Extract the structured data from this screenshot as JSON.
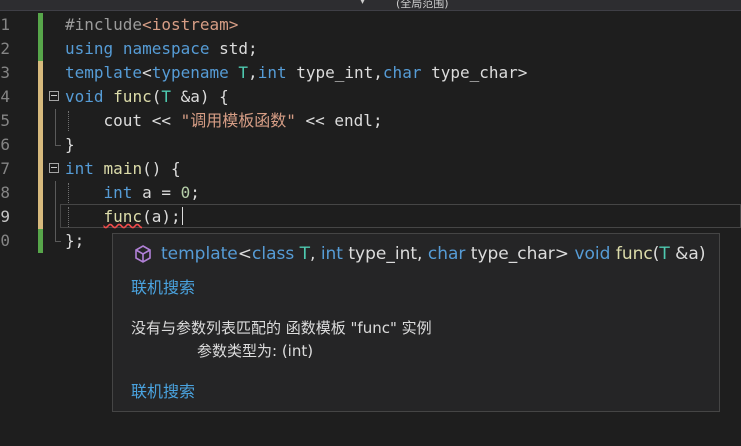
{
  "topbar": {
    "scope_arrow": "▾",
    "scope_label": "(全局范围)"
  },
  "editor": {
    "lines": [
      {
        "num": "1",
        "tokens": [
          {
            "t": "#include",
            "c": "pp"
          },
          {
            "t": "<iostream>",
            "c": "inc"
          }
        ]
      },
      {
        "num": "2",
        "tokens": [
          {
            "t": "using",
            "c": "kw"
          },
          {
            "t": " ",
            "c": "pl"
          },
          {
            "t": "namespace",
            "c": "kw"
          },
          {
            "t": " std;",
            "c": "pl"
          }
        ]
      },
      {
        "num": "3",
        "tokens": [
          {
            "t": "template",
            "c": "kw"
          },
          {
            "t": "<",
            "c": "pl"
          },
          {
            "t": "typename",
            "c": "kw"
          },
          {
            "t": " ",
            "c": "pl"
          },
          {
            "t": "T",
            "c": "tp"
          },
          {
            "t": ",",
            "c": "pl"
          },
          {
            "t": "int",
            "c": "kw"
          },
          {
            "t": " type_int,",
            "c": "pl"
          },
          {
            "t": "char",
            "c": "kw"
          },
          {
            "t": " type_char>",
            "c": "pl"
          }
        ]
      },
      {
        "num": "4",
        "tokens": [
          {
            "t": "void",
            "c": "kw"
          },
          {
            "t": " ",
            "c": "pl"
          },
          {
            "t": "func",
            "c": "fn"
          },
          {
            "t": "(",
            "c": "pl"
          },
          {
            "t": "T",
            "c": "tp"
          },
          {
            "t": " &a) {",
            "c": "pl"
          }
        ]
      },
      {
        "num": "5",
        "tokens": [
          {
            "t": "    cout << ",
            "c": "pl"
          },
          {
            "t": "\"调用模板函数\"",
            "c": "str"
          },
          {
            "t": " << endl;",
            "c": "pl"
          }
        ]
      },
      {
        "num": "6",
        "tokens": [
          {
            "t": "}",
            "c": "pl"
          }
        ]
      },
      {
        "num": "7",
        "tokens": [
          {
            "t": "int",
            "c": "kw"
          },
          {
            "t": " ",
            "c": "pl"
          },
          {
            "t": "main",
            "c": "fn"
          },
          {
            "t": "() {",
            "c": "pl"
          }
        ]
      },
      {
        "num": "8",
        "tokens": [
          {
            "t": "    ",
            "c": "pl"
          },
          {
            "t": "int",
            "c": "kw"
          },
          {
            "t": " a = ",
            "c": "pl"
          },
          {
            "t": "0",
            "c": "num"
          },
          {
            "t": ";",
            "c": "pl"
          }
        ]
      },
      {
        "num": "9",
        "tokens": [
          {
            "t": "    ",
            "c": "pl"
          },
          {
            "t": "func",
            "c": "fn squig"
          },
          {
            "t": "(a);",
            "c": "pl"
          }
        ]
      },
      {
        "num": "0",
        "tokens": [
          {
            "t": "};",
            "c": "pl"
          }
        ]
      }
    ]
  },
  "tooltip": {
    "signature": [
      {
        "t": "template",
        "c": "kw"
      },
      {
        "t": "<",
        "c": "pl"
      },
      {
        "t": "class",
        "c": "kw"
      },
      {
        "t": " ",
        "c": "pl"
      },
      {
        "t": "T",
        "c": "tp"
      },
      {
        "t": ", ",
        "c": "pl"
      },
      {
        "t": "int",
        "c": "kw"
      },
      {
        "t": " type_int, ",
        "c": "pl"
      },
      {
        "t": "char",
        "c": "kw"
      },
      {
        "t": " type_char> ",
        "c": "pl"
      },
      {
        "t": "void",
        "c": "kw"
      },
      {
        "t": " ",
        "c": "pl"
      },
      {
        "t": "func",
        "c": "fn"
      },
      {
        "t": "(",
        "c": "pl"
      },
      {
        "t": "T",
        "c": "tp"
      },
      {
        "t": " &a)",
        "c": "pl"
      }
    ],
    "search_online_1": "联机搜索",
    "error_line_1": "没有与参数列表匹配的 函数模板 \"func\" 实例",
    "error_line_2": "参数类型为:  (int)",
    "search_online_2": "联机搜索",
    "icon": "cube-icon",
    "icon_color": "#b180d7"
  },
  "colors": {
    "keyword": "#569cd6",
    "string": "#d69d85",
    "type": "#4ec9b0",
    "function": "#dcdcaa",
    "number": "#b5cea8",
    "link": "#4aa3df",
    "error": "#f14c4c",
    "change_saved": "#57a64a",
    "change_unsaved": "#d7ba7d"
  }
}
